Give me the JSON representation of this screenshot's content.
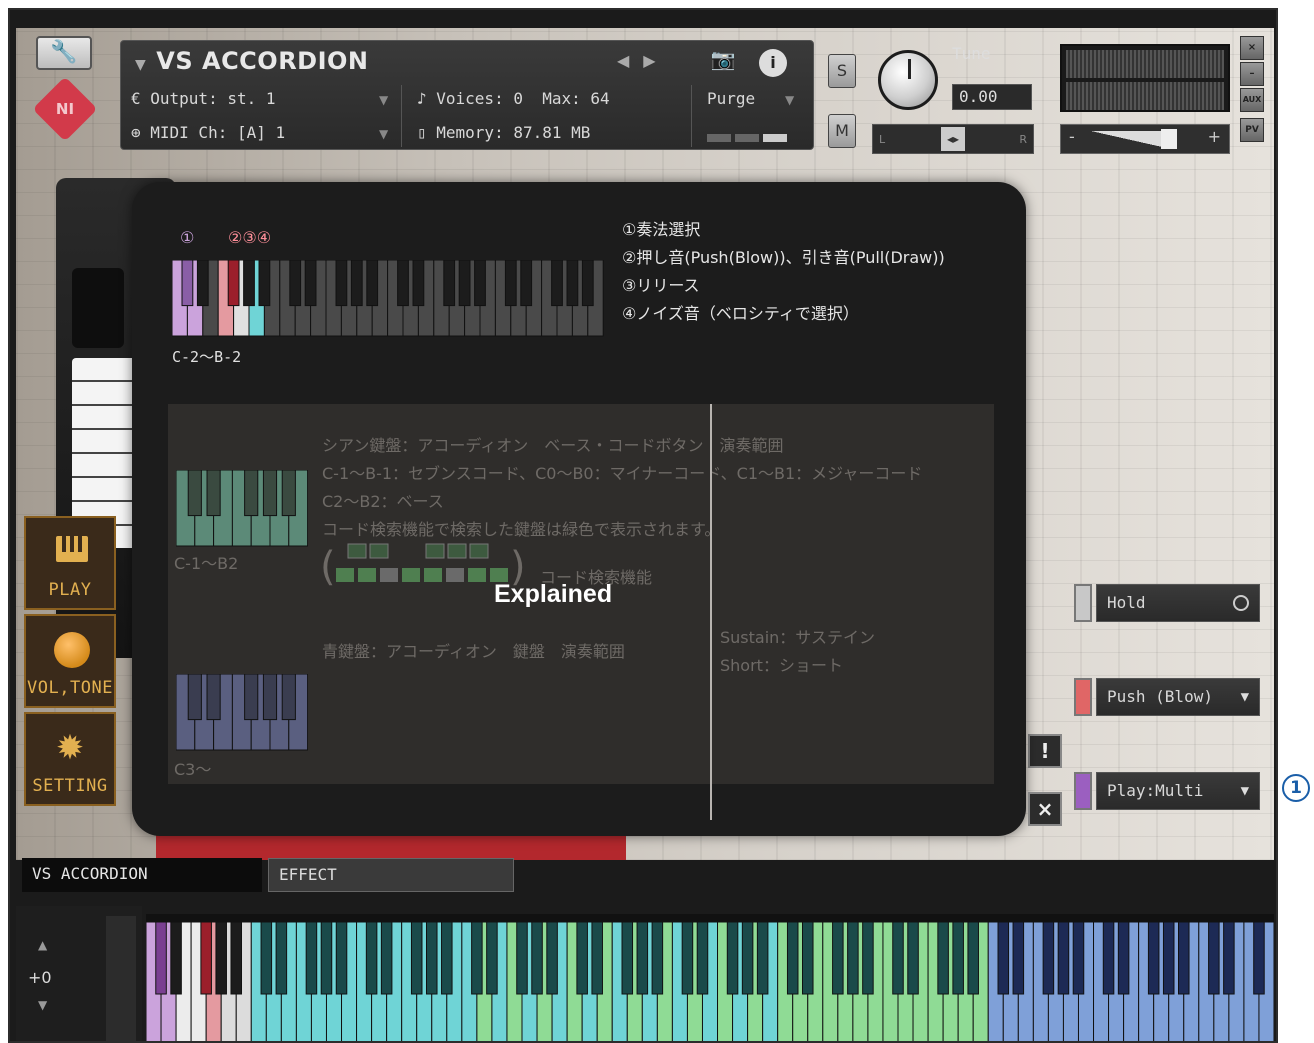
{
  "header": {
    "instrument_name": "VS ACCORDION",
    "output_label": "Output:",
    "output_value": "st. 1",
    "midi_label": "MIDI Ch:",
    "midi_value": "[A] 1",
    "voices_label": "Voices:",
    "voices_value": "0",
    "max_label": "Max:",
    "max_value": "64",
    "memory_label": "Memory:",
    "memory_value": "87.81 MB",
    "purge_label": "Purge",
    "info_label": "i",
    "solo_label": "S",
    "mute_label": "M",
    "tune_label": "Tune",
    "tune_value": "0.00",
    "pan_left": "L",
    "pan_right": "R",
    "vol_minus": "-",
    "vol_plus": "+",
    "close_label": "×",
    "minimize_label": "–",
    "aux_label": "AUX",
    "pv_label": "PV",
    "ni_logo": "NI"
  },
  "nav": {
    "play": "PLAY",
    "voltone": "VOL,TONE",
    "setting": "SETTING"
  },
  "overlay": {
    "marker1": "①",
    "marker234": "②③④",
    "range_low": "C-2～B-2",
    "legend": [
      "①奏法選択",
      "②押し音(Push(Blow))、引き音(Pull(Draw))",
      "③リリース",
      "④ノイズ音（ベロシティで選択）"
    ],
    "cyan_title": "シアン鍵盤：アコーディオン　ベース・コードボタン　演奏範囲",
    "cyan_line1": "C-1～B-1：セブンスコード、C0～B0：マイナーコード、C1～B1：メジャーコード",
    "cyan_line2": "C2～B2：ベース",
    "cyan_line3": "コード検索機能で検索した鍵盤は緑色で表示されます。",
    "range_mid": "C-1～B2",
    "chord_search": "コード検索機能",
    "blue_title": "青鍵盤：アコーディオン　鍵盤　演奏範囲",
    "range_high": "C3～",
    "sustain": "Sustain：サステイン",
    "short": "Short：ショート",
    "explained": "Explained"
  },
  "controls": {
    "hold": "Hold",
    "push": "Push (Blow)",
    "play_mode": "Play:Multi",
    "alert": "!",
    "close": "×",
    "hold_color": "#c8c8c8",
    "push_color": "#e06666",
    "play_color": "#9b5fc0"
  },
  "tabs": {
    "main": "VS ACCORDION",
    "effect": "EFFECT"
  },
  "keyboard": {
    "octave_shift": "+0",
    "up": "▲",
    "down": "▼"
  },
  "callout": "1",
  "colors": {
    "purple_key": "#cba3dc",
    "red_key": "#e49aa0",
    "cyan_key": "#6fd4d6",
    "green_key": "#8fdb95",
    "blue_key": "#7fa0d8"
  }
}
